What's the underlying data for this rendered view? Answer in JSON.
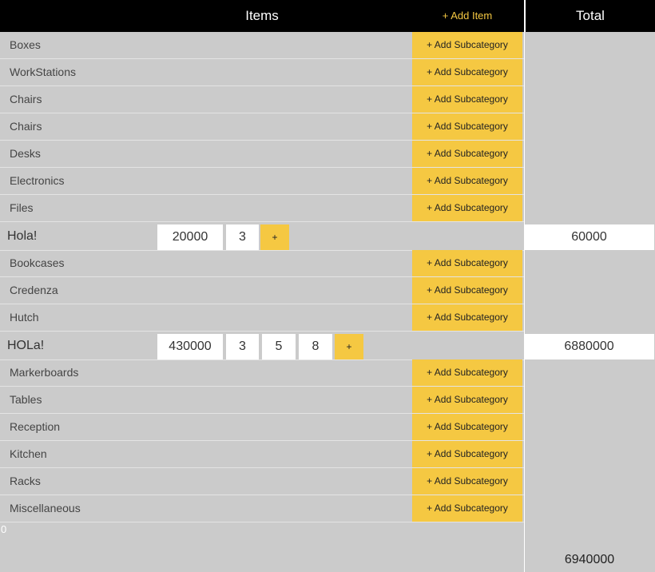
{
  "header": {
    "items_title": "Items",
    "add_item_label": "+ Add Item",
    "total_title": "Total"
  },
  "subcategory_label": "+ Add Subcategory",
  "categories": [
    "Boxes",
    "WorkStations",
    "Chairs",
    "Chairs",
    "Desks",
    "Electronics",
    "Files",
    "Bookcases",
    "Credenza",
    "Hutch",
    "Markerboards",
    "Tables",
    "Reception",
    "Kitchen",
    "Racks",
    "Miscellaneous"
  ],
  "items": [
    {
      "name": "Hola!",
      "values": [
        "20000",
        "3"
      ],
      "plus_label": "+",
      "total": "60000"
    },
    {
      "name": "HOLa!",
      "values": [
        "430000",
        "3",
        "5",
        "8"
      ],
      "plus_label": "+",
      "total": "6880000"
    }
  ],
  "footer": {
    "zero_text": "0",
    "grand_total": "6940000"
  },
  "colors": {
    "header_bg": "#000000",
    "accent": "#f5c842",
    "panel_bg": "#cbcbcb",
    "cell_bg": "#ffffff"
  }
}
